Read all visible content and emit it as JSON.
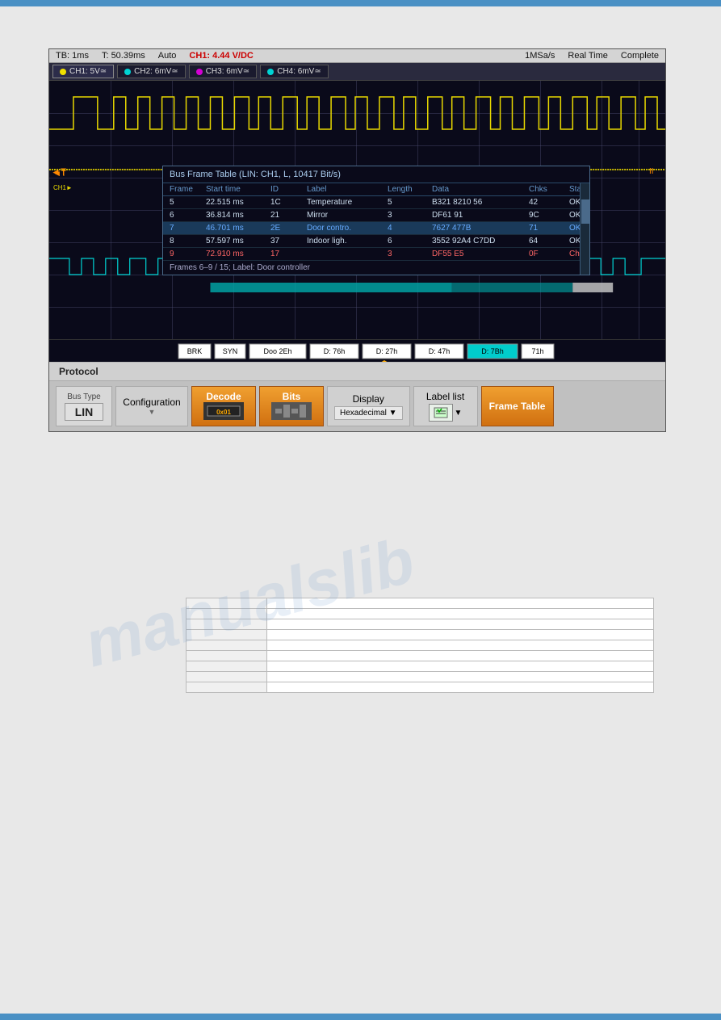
{
  "top_bar": {
    "color": "#4a90c4"
  },
  "bottom_bar": {
    "color": "#4a90c4"
  },
  "status_bar": {
    "tb": "TB: 1ms",
    "t": "T: 50.39ms",
    "mode": "Auto",
    "ch1_val": "CH1: 4.44 V/DC",
    "sample_rate": "1MSa/s",
    "time_mode": "Real Time",
    "status": "Complete"
  },
  "channels": [
    {
      "id": "ch1",
      "label": "CH1: 5V≃",
      "active": true,
      "dot_color": "yellow"
    },
    {
      "id": "ch2",
      "label": "CH2: 6mV≃",
      "active": false,
      "dot_color": "cyan"
    },
    {
      "id": "ch3",
      "label": "CH3: 6mV≃",
      "active": false,
      "dot_color": "magenta"
    },
    {
      "id": "ch4",
      "label": "CH4: 6mV≃",
      "active": false,
      "dot_color": "cyan"
    }
  ],
  "bus_frame_table": {
    "title": "Bus Frame Table (LIN: CH1, L, 10417 Bit/s)",
    "headers": [
      "Frame",
      "Start time",
      "ID",
      "Label",
      "Length",
      "Data",
      "",
      "Chks",
      "State"
    ],
    "rows": [
      {
        "frame": "5",
        "start_time": "22.515 ms",
        "id": "1C",
        "label": "Temperature",
        "length": "5",
        "data": "B321 8210 56",
        "chks": "42",
        "state": "OK",
        "highlight": false
      },
      {
        "frame": "6",
        "start_time": "36.814 ms",
        "id": "21",
        "label": "Mirror",
        "length": "3",
        "data": "DF61 91",
        "chks": "9C",
        "state": "OK",
        "highlight": false
      },
      {
        "frame": "7",
        "start_time": "46.701 ms",
        "id": "2E",
        "label": "Door contro.",
        "length": "4",
        "data": "7627 477B",
        "chks": "71",
        "state": "OK",
        "highlight": true
      },
      {
        "frame": "8",
        "start_time": "57.597 ms",
        "id": "37",
        "label": "Indoor ligh.",
        "length": "6",
        "data": "3552 92A4 C7DD",
        "chks": "64",
        "state": "OK",
        "highlight": false
      },
      {
        "frame": "9",
        "start_time": "72.910 ms",
        "id": "17",
        "label": "",
        "length": "3",
        "data": "DF55 E5",
        "chks": "0F",
        "state": "Chks",
        "highlight": false,
        "error": true
      }
    ],
    "footer": "Frames 6–9 / 15; Label: Door controller"
  },
  "decode_labels": [
    {
      "text": "BRK",
      "type": "white"
    },
    {
      "text": "SYN",
      "type": "white"
    },
    {
      "text": "Doo 2Eh",
      "type": "white"
    },
    {
      "text": "D: 76h",
      "type": "white"
    },
    {
      "text": "D: 27h",
      "type": "white"
    },
    {
      "text": "D: 47h",
      "type": "white"
    },
    {
      "text": "D: 7Bh",
      "type": "cyan"
    },
    {
      "text": "71h",
      "type": "white"
    }
  ],
  "protocol": {
    "label": "Protocol",
    "bus_type_label": "Bus Type",
    "bus_type_value": "LIN",
    "configuration_label": "Configuration",
    "decode_label": "Decode",
    "decode_sub": "0x01",
    "bits_label": "Bits",
    "display_label": "Display",
    "display_value": "Hexadecimal",
    "label_list_label": "Label list",
    "frame_table_label": "Frame Table"
  },
  "empty_table": {
    "rows": [
      [
        "",
        ""
      ],
      [
        "",
        ""
      ],
      [
        "",
        ""
      ],
      [
        "",
        ""
      ],
      [
        "",
        ""
      ],
      [
        "",
        ""
      ],
      [
        "",
        ""
      ],
      [
        "",
        ""
      ],
      [
        "",
        ""
      ]
    ]
  },
  "watermark": "manualslib"
}
